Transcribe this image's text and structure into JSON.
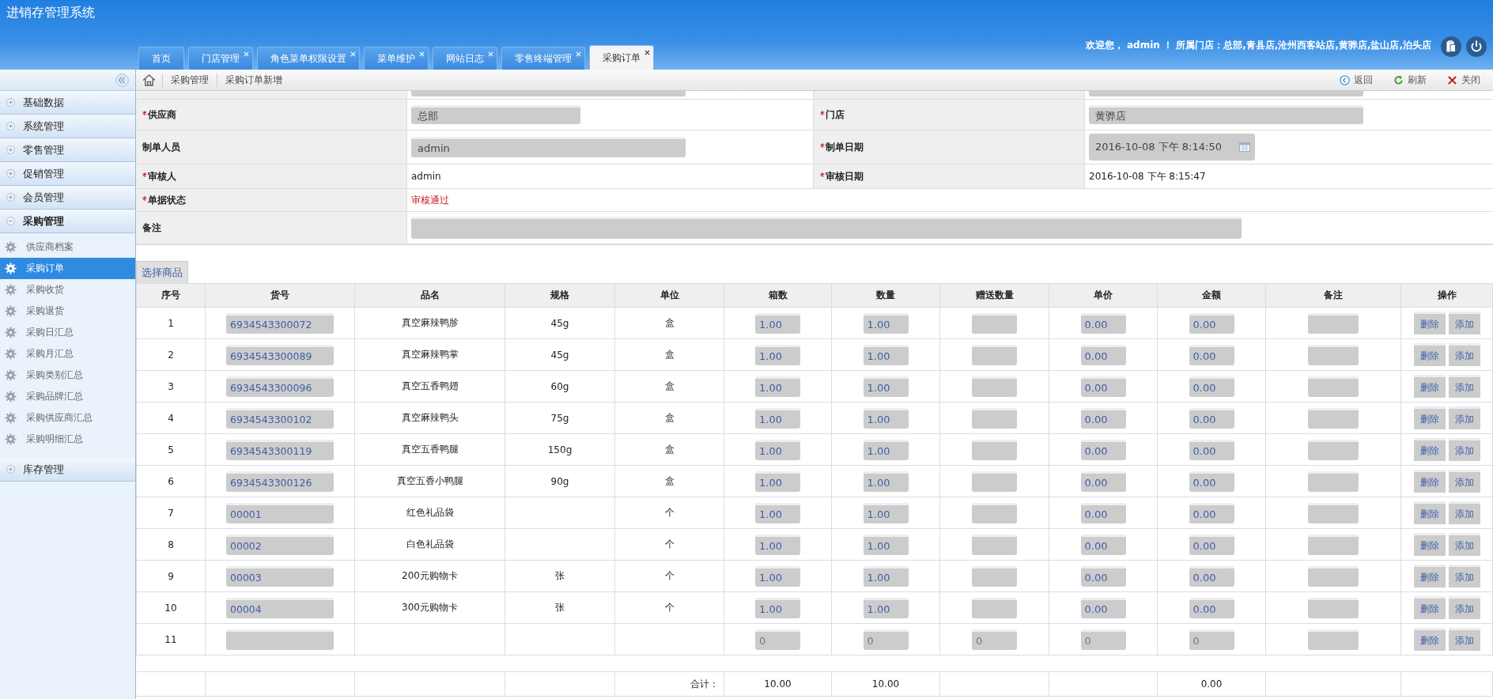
{
  "app_title": "进销存管理系统",
  "tabs": [
    {
      "label": "首页",
      "selected": false,
      "closable": false
    },
    {
      "label": "门店管理",
      "selected": false,
      "closable": true
    },
    {
      "label": "角色菜单权限设置",
      "selected": false,
      "closable": true
    },
    {
      "label": "菜单维护",
      "selected": false,
      "closable": true
    },
    {
      "label": "网站日志",
      "selected": false,
      "closable": true
    },
    {
      "label": "零售终端管理",
      "selected": false,
      "closable": true
    },
    {
      "label": "采购订单",
      "selected": true,
      "closable": true
    }
  ],
  "welcome": "欢迎您， admin ！ 所属门店：总部,青县店,沧州西客站店,黄骅店,盐山店,泊头店",
  "sidebar": [
    {
      "label": "基础数据",
      "expanded": false
    },
    {
      "label": "系统管理",
      "expanded": false
    },
    {
      "label": "零售管理",
      "expanded": false
    },
    {
      "label": "促销管理",
      "expanded": false
    },
    {
      "label": "会员管理",
      "expanded": false
    },
    {
      "label": "采购管理",
      "expanded": true,
      "children": [
        {
          "label": "供应商档案",
          "selected": false
        },
        {
          "label": "采购订单",
          "selected": true
        },
        {
          "label": "采购收货",
          "selected": false
        },
        {
          "label": "采购退货",
          "selected": false
        },
        {
          "label": "采购日汇总",
          "selected": false
        },
        {
          "label": "采购月汇总",
          "selected": false
        },
        {
          "label": "采购类别汇总",
          "selected": false
        },
        {
          "label": "采购品牌汇总",
          "selected": false
        },
        {
          "label": "采购供应商汇总",
          "selected": false
        },
        {
          "label": "采购明细汇总",
          "selected": false
        }
      ]
    },
    {
      "label": "库存管理",
      "expanded": false
    }
  ],
  "breadcrumb": [
    "采购管理",
    "采购订单新增"
  ],
  "toolbar": [
    {
      "kind": "back",
      "label": "返回"
    },
    {
      "kind": "refresh",
      "label": "刷新"
    },
    {
      "kind": "close",
      "label": "关闭"
    }
  ],
  "form": [
    {
      "clipped": true,
      "cells": [
        {
          "kind": "input"
        },
        {
          "kind": "input"
        }
      ]
    },
    {
      "cells": [
        {
          "label": "供应商",
          "required": true,
          "kind": "input",
          "value": "总部"
        },
        {
          "label": "门店",
          "required": true,
          "kind": "input",
          "value": "黄骅店"
        }
      ]
    },
    {
      "cells": [
        {
          "label": "制单人员",
          "required": false,
          "kind": "input",
          "value": "admin"
        },
        {
          "label": "制单日期",
          "required": true,
          "kind": "date",
          "value": "2016-10-08 下午 8:14:50"
        }
      ]
    },
    {
      "cells": [
        {
          "label": "审核人",
          "required": true,
          "kind": "text",
          "value": "admin"
        },
        {
          "label": "审核日期",
          "required": true,
          "kind": "text",
          "value": "2016-10-08 下午 8:15:47"
        }
      ]
    },
    {
      "cells": [
        {
          "label": "单据状态",
          "required": true,
          "kind": "status",
          "value": "审核通过"
        }
      ]
    },
    {
      "cells": [
        {
          "label": "备注",
          "required": false,
          "kind": "wide"
        }
      ]
    }
  ],
  "select_goods": "选择商品",
  "table": {
    "columns": [
      "序号",
      "货号",
      "品名",
      "规格",
      "单位",
      "箱数",
      "数量",
      "赠送数量",
      "单价",
      "金额",
      "备注",
      "操作"
    ],
    "rows": [
      {
        "no": "1",
        "code": {
          "value": "6934543300072"
        },
        "name": "真空麻辣鸭胗",
        "spec": "45g",
        "unit": "盒",
        "boxes": {
          "value": "1.00"
        },
        "qty": {
          "value": "1.00"
        },
        "gift": {},
        "price": {
          "value": "0.00"
        },
        "amount": {
          "value": "0.00"
        },
        "actions": [
          "删除",
          "添加"
        ]
      },
      {
        "no": "2",
        "code": {
          "value": "6934543300089"
        },
        "name": "真空麻辣鸭掌",
        "spec": "45g",
        "unit": "盒",
        "boxes": {
          "value": "1.00"
        },
        "qty": {
          "value": "1.00"
        },
        "gift": {},
        "price": {
          "value": "0.00"
        },
        "amount": {
          "value": "0.00"
        },
        "actions": [
          "删除",
          "添加"
        ]
      },
      {
        "no": "3",
        "code": {
          "value": "6934543300096"
        },
        "name": "真空五香鸭翅",
        "spec": "60g",
        "unit": "盒",
        "boxes": {
          "value": "1.00"
        },
        "qty": {
          "value": "1.00"
        },
        "gift": {},
        "price": {
          "value": "0.00"
        },
        "amount": {
          "value": "0.00"
        },
        "actions": [
          "删除",
          "添加"
        ]
      },
      {
        "no": "4",
        "code": {
          "value": "6934543300102"
        },
        "name": "真空麻辣鸭头",
        "spec": "75g",
        "unit": "盒",
        "boxes": {
          "value": "1.00"
        },
        "qty": {
          "value": "1.00"
        },
        "gift": {},
        "price": {
          "value": "0.00"
        },
        "amount": {
          "value": "0.00"
        },
        "actions": [
          "删除",
          "添加"
        ]
      },
      {
        "no": "5",
        "code": {
          "value": "6934543300119"
        },
        "name": "真空五香鸭腿",
        "spec": "150g",
        "unit": "盒",
        "boxes": {
          "value": "1.00"
        },
        "qty": {
          "value": "1.00"
        },
        "gift": {},
        "price": {
          "value": "0.00"
        },
        "amount": {
          "value": "0.00"
        },
        "actions": [
          "删除",
          "添加"
        ]
      },
      {
        "no": "6",
        "code": {
          "value": "6934543300126"
        },
        "name": "真空五香小鸭腿",
        "spec": "90g",
        "unit": "盒",
        "boxes": {
          "value": "1.00"
        },
        "qty": {
          "value": "1.00"
        },
        "gift": {},
        "price": {
          "value": "0.00"
        },
        "amount": {
          "value": "0.00"
        },
        "actions": [
          "删除",
          "添加"
        ]
      },
      {
        "no": "7",
        "code": {
          "value": "00001"
        },
        "name": "红色礼品袋",
        "unit": "个",
        "boxes": {
          "value": "1.00"
        },
        "qty": {
          "value": "1.00"
        },
        "gift": {},
        "price": {
          "value": "0.00"
        },
        "amount": {
          "value": "0.00"
        },
        "actions": [
          "删除",
          "添加"
        ]
      },
      {
        "no": "8",
        "code": {
          "value": "00002"
        },
        "name": "白色礼品袋",
        "unit": "个",
        "boxes": {
          "value": "1.00"
        },
        "qty": {
          "value": "1.00"
        },
        "gift": {},
        "price": {
          "value": "0.00"
        },
        "amount": {
          "value": "0.00"
        },
        "actions": [
          "删除",
          "添加"
        ]
      },
      {
        "no": "9",
        "code": {
          "value": "00003"
        },
        "name": "200元购物卡",
        "spec": "张",
        "unit": "个",
        "boxes": {
          "value": "1.00"
        },
        "qty": {
          "value": "1.00"
        },
        "gift": {},
        "price": {
          "value": "0.00"
        },
        "amount": {
          "value": "0.00"
        },
        "actions": [
          "删除",
          "添加"
        ]
      },
      {
        "no": "10",
        "code": {
          "value": "00004"
        },
        "name": "300元购物卡",
        "spec": "张",
        "unit": "个",
        "boxes": {
          "value": "1.00"
        },
        "qty": {
          "value": "1.00"
        },
        "gift": {},
        "price": {
          "value": "0.00"
        },
        "amount": {
          "value": "0.00"
        },
        "actions": [
          "删除",
          "添加"
        ]
      },
      {
        "no": "11",
        "code": {},
        "boxes": {
          "placeholder": "0"
        },
        "qty": {
          "placeholder": "0"
        },
        "gift": {
          "placeholder": "0"
        },
        "price": {
          "placeholder": "0"
        },
        "amount": {
          "placeholder": "0"
        },
        "actions": [
          "删除",
          "添加"
        ]
      }
    ],
    "totals": {
      "label": "合计：",
      "boxes": "10.00",
      "qty": "10.00",
      "amount": "0.00"
    }
  }
}
